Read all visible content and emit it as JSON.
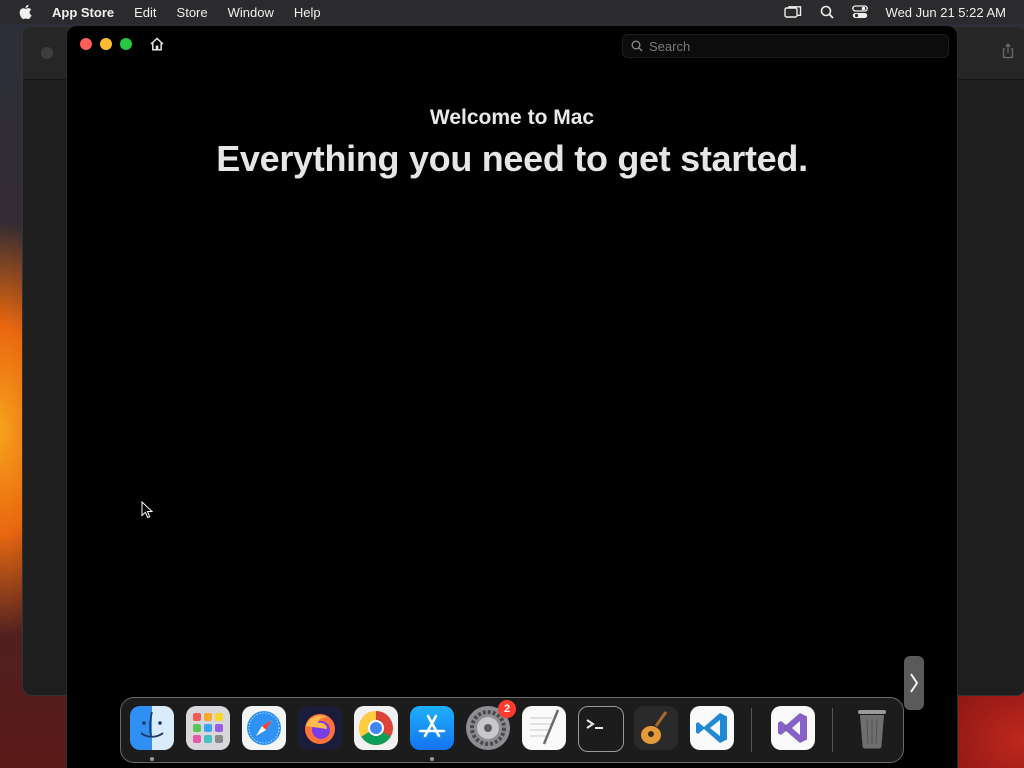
{
  "menubar": {
    "app_name": "App Store",
    "menus": [
      "Edit",
      "Store",
      "Window",
      "Help"
    ],
    "clock": "Wed Jun 21  5:22 AM"
  },
  "window": {
    "search_placeholder": "Search",
    "welcome": "Welcome to Mac",
    "headline": "Everything you need to get started."
  },
  "dock": {
    "items": [
      {
        "name": "Finder",
        "icon": "finder-icon",
        "running": true
      },
      {
        "name": "Launchpad",
        "icon": "launchpad-icon",
        "running": false
      },
      {
        "name": "Safari",
        "icon": "safari-icon",
        "running": false
      },
      {
        "name": "Firefox",
        "icon": "firefox-icon",
        "running": false
      },
      {
        "name": "Chrome",
        "icon": "chrome-icon",
        "running": false
      },
      {
        "name": "App Store",
        "icon": "app-store-icon",
        "running": true
      },
      {
        "name": "System Settings",
        "icon": "system-settings-icon",
        "running": false,
        "badge": "2"
      },
      {
        "name": "TextEdit",
        "icon": "textedit-icon",
        "running": false
      },
      {
        "name": "Terminal",
        "icon": "terminal-icon",
        "running": false
      },
      {
        "name": "GarageBand",
        "icon": "garageband-icon",
        "running": false
      },
      {
        "name": "Visual Studio Code",
        "icon": "vscode-icon",
        "running": false
      },
      {
        "name": "Visual Studio",
        "icon": "visual-studio-icon",
        "running": false
      },
      {
        "name": "Trash",
        "icon": "trash-icon",
        "running": false
      }
    ]
  },
  "colors": {
    "close": "#fe5f57",
    "minimize": "#febc2e",
    "maximize": "#28c840",
    "badge": "#ff3b30"
  }
}
